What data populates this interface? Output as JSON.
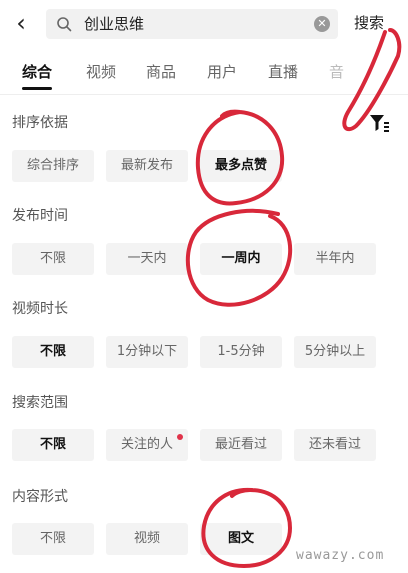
{
  "search": {
    "query": "创业思维",
    "button": "搜索"
  },
  "tabs": [
    "综合",
    "视频",
    "商品",
    "用户",
    "直播",
    "音"
  ],
  "sections": [
    {
      "title": "排序依据",
      "options": [
        "综合排序",
        "最新发布",
        "最多点赞"
      ],
      "selected": "最多点赞"
    },
    {
      "title": "发布时间",
      "options": [
        "不限",
        "一天内",
        "一周内",
        "半年内"
      ],
      "selected": "一周内"
    },
    {
      "title": "视频时长",
      "options": [
        "不限",
        "1分钟以下",
        "1-5分钟",
        "5分钟以上"
      ],
      "selected": "不限"
    },
    {
      "title": "搜索范围",
      "options": [
        "不限",
        "关注的人",
        "最近看过",
        "还未看过"
      ],
      "selected": "不限"
    },
    {
      "title": "内容形式",
      "options": [
        "不限",
        "视频",
        "图文"
      ],
      "selected": "图文"
    }
  ],
  "watermark": "wawazy.com",
  "annotation_color": "#d8283a"
}
